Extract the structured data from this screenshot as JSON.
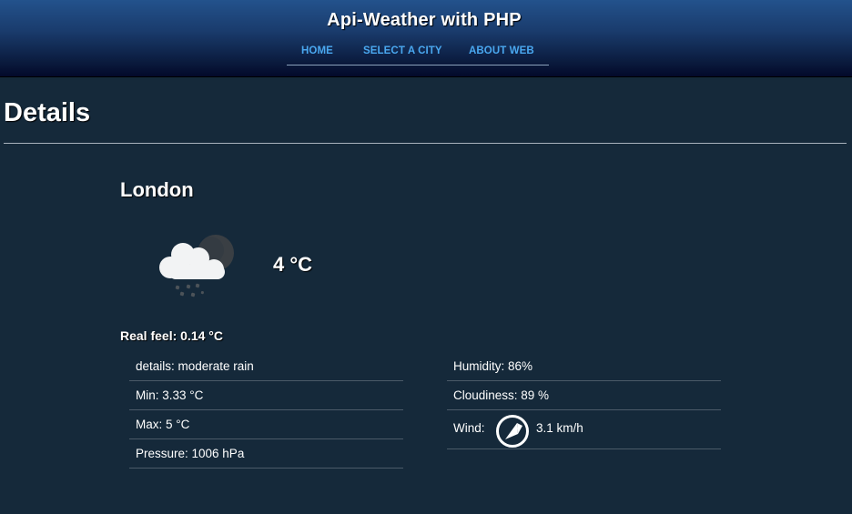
{
  "header": {
    "title": "Api-Weather with PHP",
    "nav": [
      "HOME",
      "SELECT A CITY",
      "ABOUT WEB"
    ]
  },
  "page": {
    "title": "Details"
  },
  "weather": {
    "city": "London",
    "icon": "cloud-rain-night-icon",
    "temperature": "4 °C",
    "real_feel": "Real feel: 0.14 °C",
    "left_rows": [
      "details: moderate rain",
      "Min: 3.33 °C",
      "Max: 5 °C",
      "Pressure: 1006 hPa"
    ],
    "right_rows": {
      "humidity": "Humidity: 86%",
      "cloudiness": "Cloudiness: 89 %",
      "wind_label": "Wind:",
      "wind_value": "3.1 km/h",
      "wind_icon": "wind-direction-icon"
    }
  },
  "colors": {
    "background": "#15293a",
    "nav_link": "#4aa8f0",
    "header_top": "#23528c",
    "header_bottom": "#03092a"
  }
}
